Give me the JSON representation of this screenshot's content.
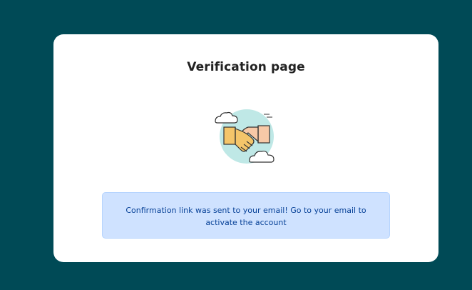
{
  "page": {
    "background_color": "#004a56"
  },
  "card": {
    "title": "Verification page",
    "illustration_icon": "handshake-icon",
    "alert": {
      "message": "Confirmation link was sent to your email! Go to your email to activate the account",
      "background_color": "#cfe2ff",
      "text_color": "#084298"
    }
  }
}
